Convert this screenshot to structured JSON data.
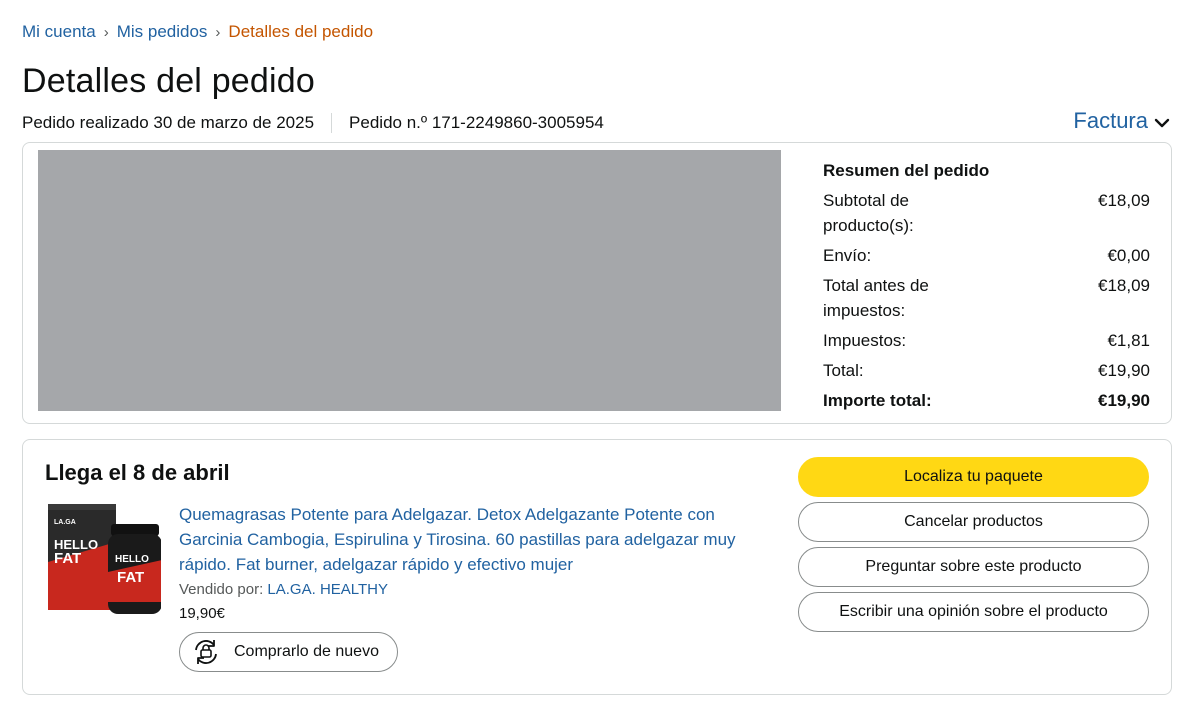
{
  "breadcrumb": {
    "items": [
      "Mi cuenta",
      "Mis pedidos"
    ],
    "current": "Detalles del pedido",
    "separator": "›"
  },
  "page_title": "Detalles del pedido",
  "order_meta": {
    "placed": "Pedido realizado 30 de marzo de 2025",
    "number": "Pedido n.º 171-2249860-3005954"
  },
  "invoice": {
    "label": "Factura",
    "icon": "chevron-down-icon"
  },
  "summary": {
    "title": "Resumen del pedido",
    "rows": [
      {
        "label": "Subtotal de producto(s):",
        "value": "€18,09"
      },
      {
        "label": "Envío:",
        "value": "€0,00"
      },
      {
        "label": "Total antes de impuestos:",
        "value": "€18,09"
      },
      {
        "label": "Impuestos:",
        "value": "€1,81"
      },
      {
        "label": "Total:",
        "value": "€19,90"
      }
    ],
    "grand_total": {
      "label": "Importe total:",
      "value": "€19,90"
    }
  },
  "shipment": {
    "arrival": "Llega el 8 de abril",
    "product": {
      "title": "Quemagrasas Potente para Adelgazar. Detox Adelgazante Potente con Garcinia Cambogia, Espirulina y Tirosina. 60 pastillas para adelgazar muy rápido. Fat burner, adelgazar rápido y efectivo mujer",
      "seller_label": "Vendido por:",
      "seller_name": "LA.GA. HEALTHY",
      "price": "19,90€",
      "image_text": [
        "HELLO",
        "FAT"
      ]
    },
    "buy_again": "Comprarlo de nuevo",
    "actions": [
      "Localiza tu paquete",
      "Cancelar productos",
      "Preguntar sobre este producto",
      "Escribir una opinión sobre el producto"
    ]
  },
  "colors": {
    "link": "#2162a1",
    "breadcrumb_current": "#c45500",
    "primary_button": "#ffd814",
    "border": "#d5d9d9",
    "redacted": "#a5a7aa"
  }
}
